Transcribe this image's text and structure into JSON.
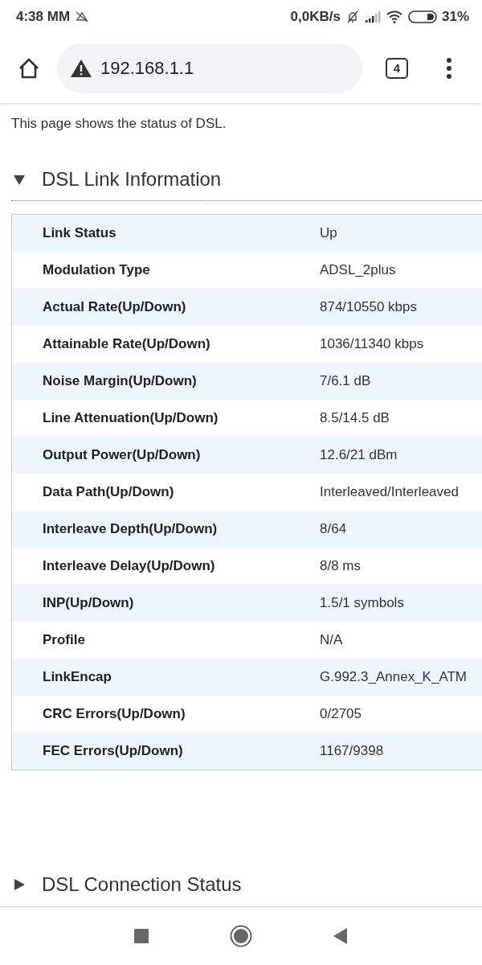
{
  "status_bar": {
    "time": "4:38 MM",
    "net_speed": "0,0KB/s",
    "battery": "31%"
  },
  "browser": {
    "url": "192.168.1.1",
    "tab_count": "4"
  },
  "page": {
    "description": "This page shows the status of DSL.",
    "sections": [
      {
        "title": "DSL Link Information",
        "expanded": true,
        "rows": [
          {
            "label": "Link Status",
            "value": "Up"
          },
          {
            "label": "Modulation Type",
            "value": "ADSL_2plus"
          },
          {
            "label": "Actual Rate(Up/Down)",
            "value": "874/10550 kbps"
          },
          {
            "label": "Attainable Rate(Up/Down)",
            "value": "1036/11340 kbps"
          },
          {
            "label": "Noise Margin(Up/Down)",
            "value": "7/6.1 dB"
          },
          {
            "label": "Line Attenuation(Up/Down)",
            "value": "8.5/14.5 dB"
          },
          {
            "label": "Output Power(Up/Down)",
            "value": "12.6/21 dBm"
          },
          {
            "label": "Data Path(Up/Down)",
            "value": "Interleaved/Interleaved"
          },
          {
            "label": "Interleave Depth(Up/Down)",
            "value": "8/64"
          },
          {
            "label": "Interleave Delay(Up/Down)",
            "value": "8/8 ms"
          },
          {
            "label": "INP(Up/Down)",
            "value": "1.5/1 symbols"
          },
          {
            "label": "Profile",
            "value": "N/A"
          },
          {
            "label": "LinkEncap",
            "value": "G.992.3_Annex_K_ATM"
          },
          {
            "label": "CRC Errors(Up/Down)",
            "value": "0/2705"
          },
          {
            "label": "FEC Errors(Up/Down)",
            "value": "1167/9398"
          }
        ]
      },
      {
        "title": "DSL Connection Status",
        "expanded": false
      }
    ]
  }
}
